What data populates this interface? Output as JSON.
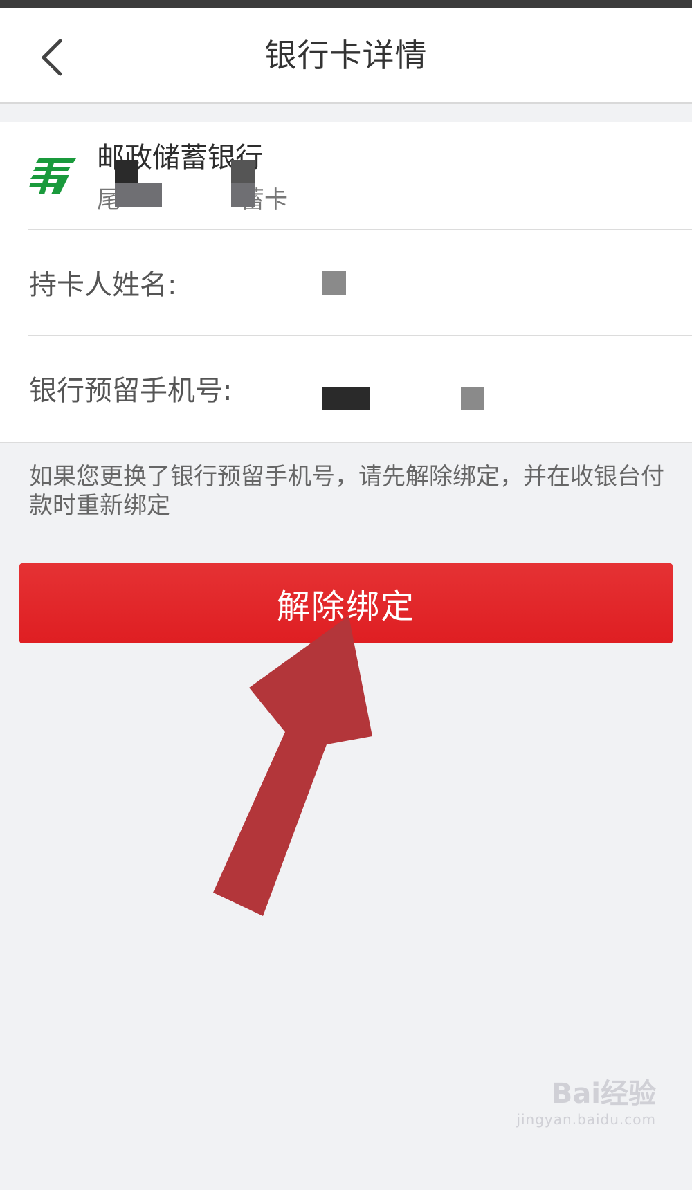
{
  "nav": {
    "title": "银行卡详情",
    "back_icon": "chevron-left-icon"
  },
  "card": {
    "bank_name": "邮政储蓄银行",
    "tail_prefix": "尾",
    "tail_suffix": "蓄卡",
    "logo_icon": "postal-bank-logo",
    "logo_color": "#1a9a3c"
  },
  "rows": {
    "holder_label": "持卡人姓名:",
    "phone_label": "银行预留手机号:"
  },
  "notice": "如果您更换了银行预留手机号，请先解除绑定，并在收银台付款时重新绑定",
  "actions": {
    "unbind_label": "解除绑定",
    "button_color": "#e02426"
  },
  "annotation": {
    "arrow_color": "#b3363a"
  },
  "watermark": {
    "brand": "Bai经验",
    "url": "jingyan.baidu.com"
  }
}
